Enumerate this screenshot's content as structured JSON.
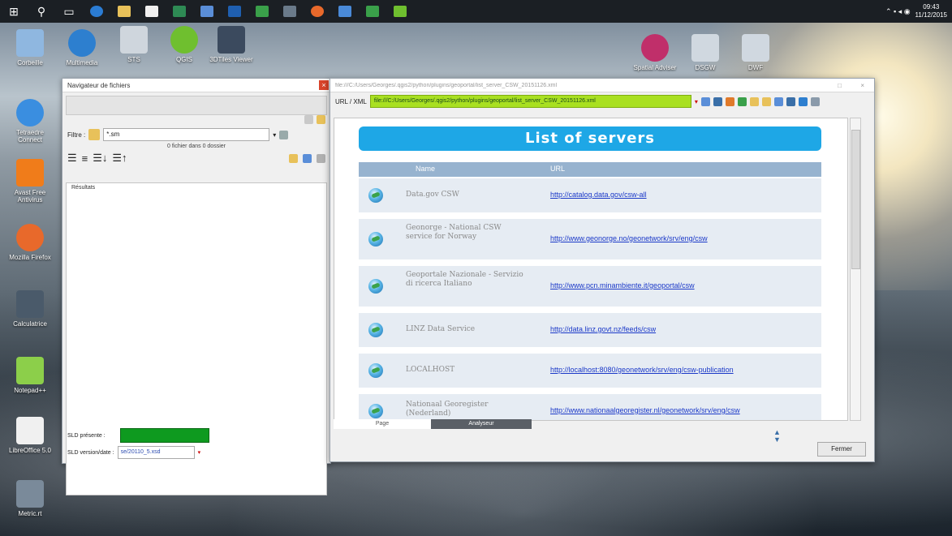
{
  "taskbar": {
    "clock_time": "09:43",
    "clock_date": "11/12/2015",
    "apps": [
      {
        "icon": "windows-icon",
        "color": "#ffffff"
      },
      {
        "icon": "search-icon",
        "color": "#ffffff"
      },
      {
        "icon": "task-view-icon",
        "color": "#ffffff"
      },
      {
        "icon": "edge-icon",
        "color": "#2b7cd3"
      },
      {
        "icon": "folder-icon",
        "color": "#2e9bd6"
      },
      {
        "icon": "store-icon",
        "color": "#ffffff"
      },
      {
        "icon": "app-icon-1",
        "color": "#2e8a54"
      },
      {
        "icon": "app-icon-2",
        "color": "#5a8ed8"
      },
      {
        "icon": "app-icon-3",
        "color": "#1f5fb0"
      },
      {
        "icon": "app-icon-4",
        "color": "#3aa04a"
      },
      {
        "icon": "app-icon-5",
        "color": "#6a7a8a"
      },
      {
        "icon": "firefox-icon",
        "color": "#e8692b"
      },
      {
        "icon": "document-icon",
        "color": "#4a8ad8"
      },
      {
        "icon": "notepad-icon",
        "color": "#3aa04a"
      },
      {
        "icon": "qgis-icon",
        "color": "#6fbf2f"
      }
    ]
  },
  "desktop": {
    "icons": [
      {
        "label": "Corbeille",
        "color": "#8fb7e0"
      },
      {
        "label": "Multimedia",
        "color": "#2d7fcf"
      },
      {
        "label": "STS",
        "color": "#cfd6dd"
      },
      {
        "label": "QGIS",
        "color": "#6fbf2f"
      },
      {
        "label": "3DTiles Viewer",
        "color": "#3b4a5e"
      },
      {
        "label": "Tetraedre Connect",
        "color": "#3a8ee0"
      },
      {
        "label": "Avast Free Antivirus",
        "color": "#f07c1a"
      },
      {
        "label": "Mozilla Firefox",
        "color": "#e8692b"
      },
      {
        "label": "Calculatrice",
        "color": "#4a5a6a"
      },
      {
        "label": "Notepad++",
        "color": "#8ccf4a"
      },
      {
        "label": "LibreOffice 5.0",
        "color": "#f0f0f0"
      },
      {
        "label": "Metric.rt",
        "color": "#7a8a9a"
      },
      {
        "label": "Spatial Adviser",
        "color": "#c02f6a"
      },
      {
        "label": "DSGW",
        "color": "#d0d8e0"
      },
      {
        "label": "DWF",
        "color": "#d0d8e0"
      }
    ]
  },
  "left_window": {
    "title": "Navigateur de fichiers",
    "close": "×",
    "filter_label": "Filtre :",
    "filter_value": "*.sm",
    "status": "0 fichier dans 0 dossier",
    "tree_root": "Résultats",
    "sld_label": "SLD présente :",
    "sld_version_label": "SLD version/date :",
    "sld_version_value": "se/20110_5.xsd"
  },
  "right_window": {
    "title": "file:///C:/Users/Georges/.qgis2/python/plugins/geoportal/list_server_CSW_20151126.xml",
    "url_label": "URL / XML",
    "url_value": "file:///C:/Users/Georges/.qgis2/python/plugins/geoportal/list_server_CSW_20151126.xml",
    "banner": "List of servers",
    "col_name": "Name",
    "col_url": "URL",
    "servers": [
      {
        "name": "Data.gov CSW",
        "url": "http://catalog.data.gov/csw-all"
      },
      {
        "name": "Geonorge - National CSW service for Norway",
        "url": "http://www.geonorge.no/geonetwork/srv/eng/csw"
      },
      {
        "name": "Geoportale Nazionale - Servizio di ricerca Italiano",
        "url": "http://www.pcn.minambiente.it/geoportal/csw"
      },
      {
        "name": "LINZ Data Service",
        "url": "http://data.linz.govt.nz/feeds/csw"
      },
      {
        "name": "LOCALHOST",
        "url": "http://localhost:8080/geonetwork/srv/eng/csw-publication"
      },
      {
        "name": "Nationaal Georegister (Nederland)",
        "url": "http://www.nationaalgeoregister.nl/geonetwork/srv/eng/csw"
      }
    ],
    "tab_page": "Page",
    "tab_analysis": "Analyseur",
    "close_button": "Fermer"
  }
}
